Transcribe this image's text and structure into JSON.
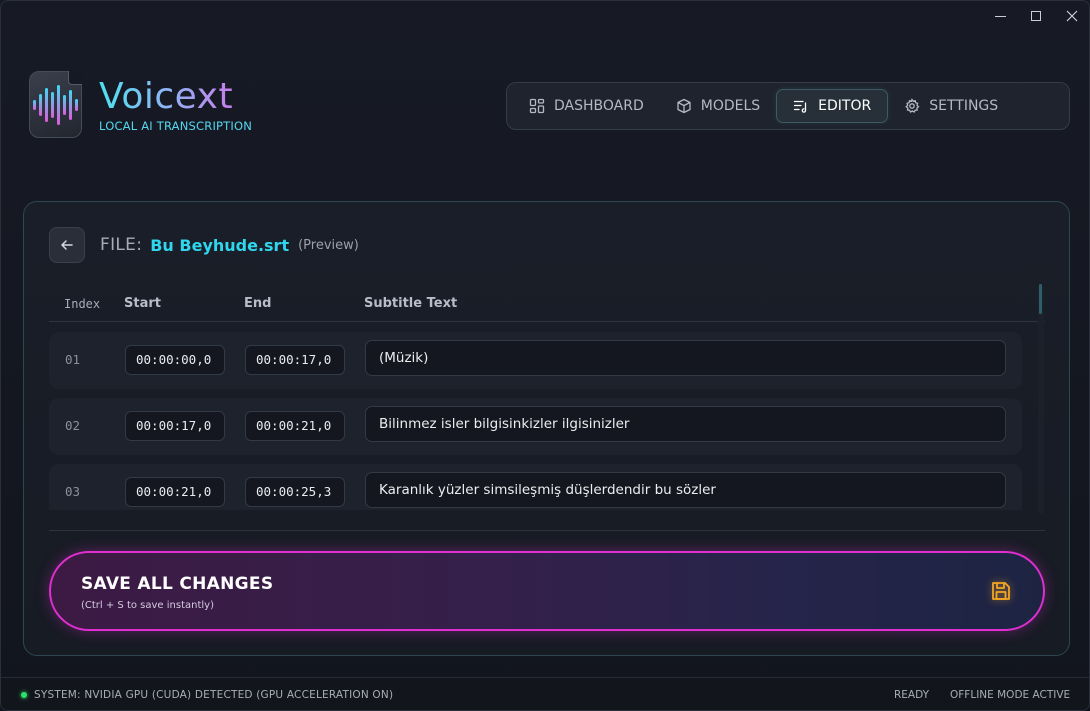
{
  "app": {
    "title": "Voicext",
    "subtitle": "LOCAL AI TRANSCRIPTION"
  },
  "nav": {
    "items": [
      {
        "label": "DASHBOARD",
        "icon": "dashboard-grid-icon",
        "active": false
      },
      {
        "label": "MODELS",
        "icon": "cube-icon",
        "active": false
      },
      {
        "label": "EDITOR",
        "icon": "edit-list-icon",
        "active": true
      },
      {
        "label": "SETTINGS",
        "icon": "gear-icon",
        "active": false
      }
    ]
  },
  "editor": {
    "file_label": "FILE:",
    "file_name": "Bu Beyhude.srt",
    "file_mode": "(Preview)",
    "columns": {
      "index": "Index",
      "start": "Start",
      "end": "End",
      "text": "Subtitle Text"
    },
    "rows": [
      {
        "index": "01",
        "start": "00:00:00,0",
        "end": "00:00:17,0",
        "text": "(Müzik)"
      },
      {
        "index": "02",
        "start": "00:00:17,0",
        "end": "00:00:21,0",
        "text": "Bilinmez isler bilgisinkizler ilgisinizler"
      },
      {
        "index": "03",
        "start": "00:00:21,0",
        "end": "00:00:25,3",
        "text": "Karanlık yüzler simsileşmiş düşlerdendir bu sözler"
      }
    ],
    "save": {
      "title": "SAVE ALL CHANGES",
      "hint": "(Ctrl + S to save instantly)",
      "icon": "floppy-disk-icon"
    }
  },
  "status": {
    "system": "SYSTEM: NVIDIA GPU (CUDA) DETECTED (GPU ACCELERATION ON)",
    "ready": "READY",
    "mode": "OFFLINE MODE ACTIVE"
  },
  "colors": {
    "accent_cyan": "#2fd6ee",
    "accent_magenta": "#e02fd0",
    "save_icon": "#f5a623",
    "status_ok": "#2ee06a"
  }
}
